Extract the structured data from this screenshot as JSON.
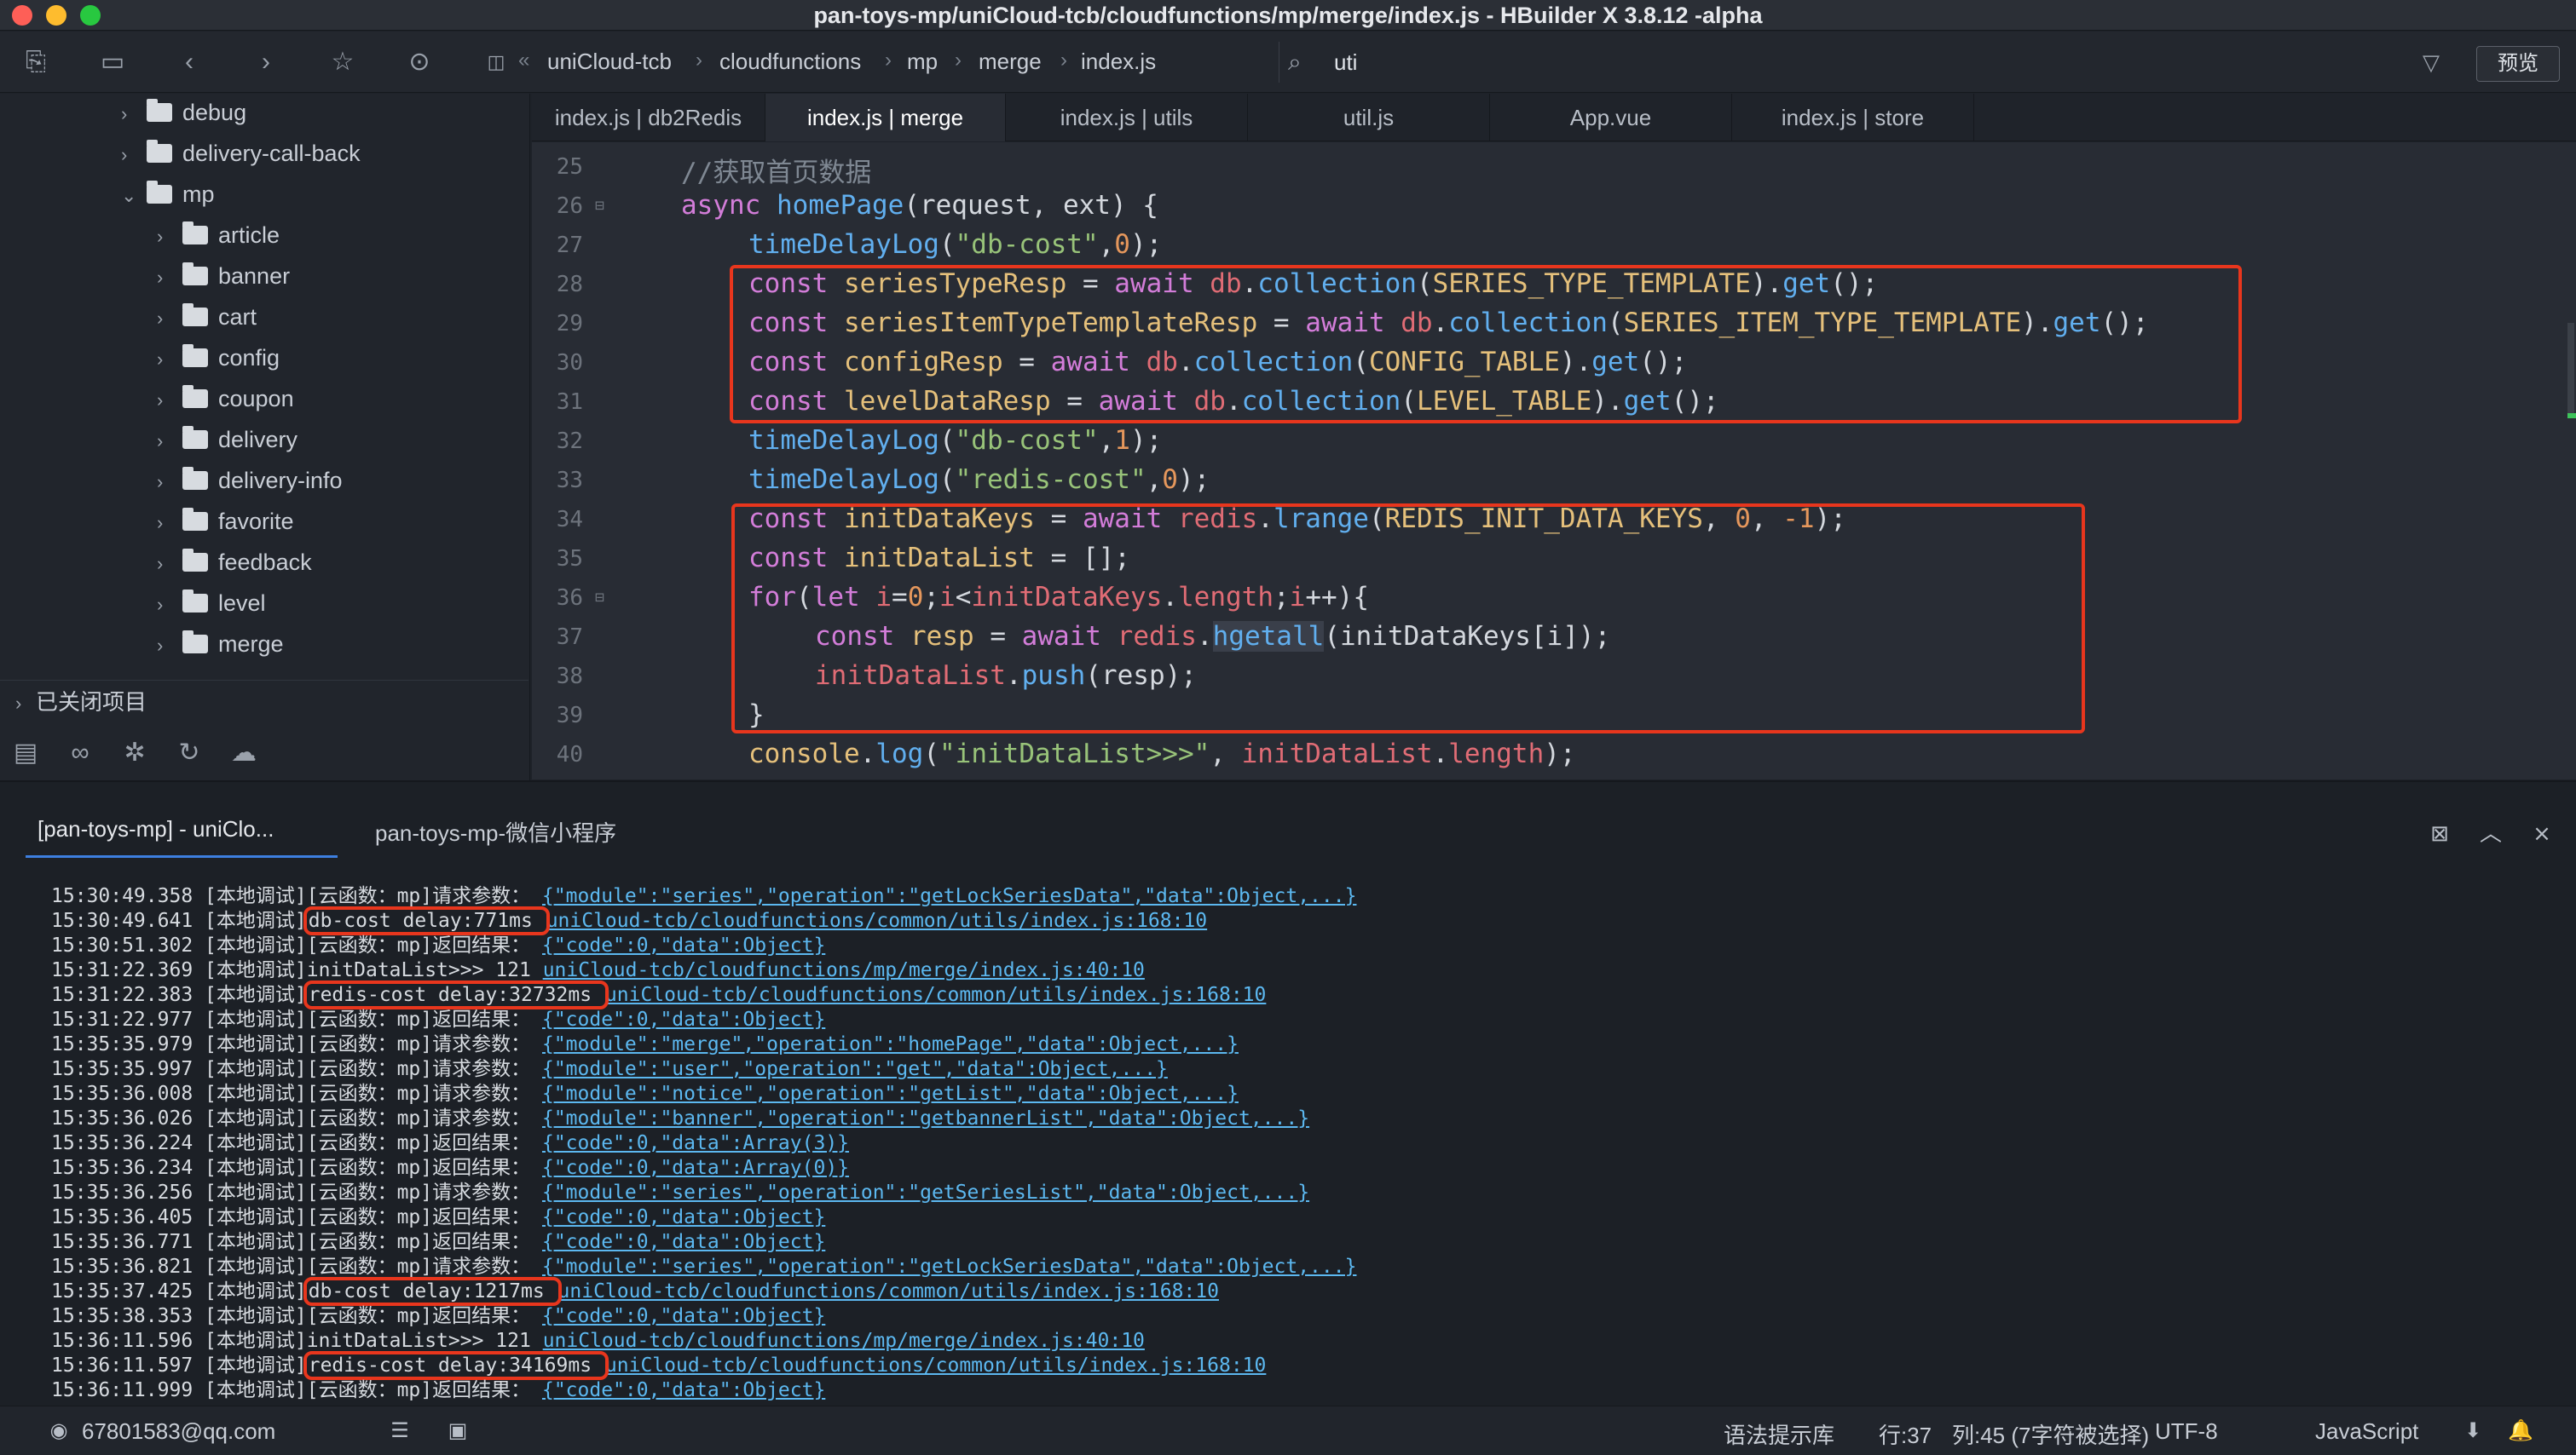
{
  "window": {
    "title": "pan-toys-mp/uniCloud-tcb/cloudfunctions/mp/merge/index.js - HBuilder X 3.8.12 -alpha"
  },
  "toolbar": {
    "breadcrumb": [
      "uniCloud-tcb",
      "cloudfunctions",
      "mp",
      "merge",
      "index.js"
    ],
    "search_value": "uti",
    "preview_label": "预览"
  },
  "sidebar": {
    "items": [
      {
        "label": "debug",
        "expanded": false,
        "level": 1
      },
      {
        "label": "delivery-call-back",
        "expanded": false,
        "level": 1
      },
      {
        "label": "mp",
        "expanded": true,
        "level": 1
      },
      {
        "label": "article",
        "expanded": false,
        "level": 2
      },
      {
        "label": "banner",
        "expanded": false,
        "level": 2
      },
      {
        "label": "cart",
        "expanded": false,
        "level": 2
      },
      {
        "label": "config",
        "expanded": false,
        "level": 2
      },
      {
        "label": "coupon",
        "expanded": false,
        "level": 2
      },
      {
        "label": "delivery",
        "expanded": false,
        "level": 2
      },
      {
        "label": "delivery-info",
        "expanded": false,
        "level": 2
      },
      {
        "label": "favorite",
        "expanded": false,
        "level": 2
      },
      {
        "label": "feedback",
        "expanded": false,
        "level": 2
      },
      {
        "label": "level",
        "expanded": false,
        "level": 2
      },
      {
        "label": "merge",
        "expanded": false,
        "level": 2
      }
    ],
    "closed_projects": "已关闭项目"
  },
  "tabs": [
    {
      "label": "index.js | db2Redis",
      "active": false
    },
    {
      "label": "index.js | merge",
      "active": true
    },
    {
      "label": "index.js | utils",
      "active": false
    },
    {
      "label": "util.js",
      "active": false
    },
    {
      "label": "App.vue",
      "active": false
    },
    {
      "label": "index.js | store",
      "active": false
    }
  ],
  "editor": {
    "line_numbers": [
      "25",
      "26",
      "27",
      "28",
      "29",
      "30",
      "31",
      "32",
      "33",
      "34",
      "35",
      "36",
      "37",
      "38",
      "39",
      "40"
    ]
  },
  "console": {
    "tabs": [
      "[pan-toys-mp] - uniClo...",
      "pan-toys-mp-微信小程序"
    ],
    "lines": [
      {
        "time": "15:30:49.358",
        "prefix": "[本地调试][云函数：mp]请求参数：",
        "text": "",
        "link": "{\"module\":\"series\",\"operation\":\"getLockSeriesData\",\"data\":Object,...}"
      },
      {
        "time": "15:30:49.641",
        "prefix": "[本地调试]",
        "text": "db-cost delay:771ms ",
        "link": "uniCloud-tcb/cloudfunctions/common/utils/index.js:168:10"
      },
      {
        "time": "15:30:51.302",
        "prefix": "[本地调试][云函数：mp]返回结果：",
        "text": "",
        "link": "{\"code\":0,\"data\":Object}"
      },
      {
        "time": "15:31:22.369",
        "prefix": "[本地调试]",
        "text": "initDataList>>> 121 ",
        "link": "uniCloud-tcb/cloudfunctions/mp/merge/index.js:40:10"
      },
      {
        "time": "15:31:22.383",
        "prefix": "[本地调试]",
        "text": "redis-cost delay:32732ms ",
        "link": "uniCloud-tcb/cloudfunctions/common/utils/index.js:168:10"
      },
      {
        "time": "15:31:22.977",
        "prefix": "[本地调试][云函数：mp]返回结果：",
        "text": "",
        "link": "{\"code\":0,\"data\":Object}"
      },
      {
        "time": "15:35:35.979",
        "prefix": "[本地调试][云函数：mp]请求参数：",
        "text": "",
        "link": "{\"module\":\"merge\",\"operation\":\"homePage\",\"data\":Object,...}"
      },
      {
        "time": "15:35:35.997",
        "prefix": "[本地调试][云函数：mp]请求参数：",
        "text": "",
        "link": "{\"module\":\"user\",\"operation\":\"get\",\"data\":Object,...}"
      },
      {
        "time": "15:35:36.008",
        "prefix": "[本地调试][云函数：mp]请求参数：",
        "text": "",
        "link": "{\"module\":\"notice\",\"operation\":\"getList\",\"data\":Object,...}"
      },
      {
        "time": "15:35:36.026",
        "prefix": "[本地调试][云函数：mp]请求参数：",
        "text": "",
        "link": "{\"module\":\"banner\",\"operation\":\"getbannerList\",\"data\":Object,...}"
      },
      {
        "time": "15:35:36.224",
        "prefix": "[本地调试][云函数：mp]返回结果：",
        "text": "",
        "link": "{\"code\":0,\"data\":Array(3)}"
      },
      {
        "time": "15:35:36.234",
        "prefix": "[本地调试][云函数：mp]返回结果：",
        "text": "",
        "link": "{\"code\":0,\"data\":Array(0)}"
      },
      {
        "time": "15:35:36.256",
        "prefix": "[本地调试][云函数：mp]请求参数：",
        "text": "",
        "link": "{\"module\":\"series\",\"operation\":\"getSeriesList\",\"data\":Object,...}"
      },
      {
        "time": "15:35:36.405",
        "prefix": "[本地调试][云函数：mp]返回结果：",
        "text": "",
        "link": "{\"code\":0,\"data\":Object}"
      },
      {
        "time": "15:35:36.771",
        "prefix": "[本地调试][云函数：mp]返回结果：",
        "text": "",
        "link": "{\"code\":0,\"data\":Object}"
      },
      {
        "time": "15:35:36.821",
        "prefix": "[本地调试][云函数：mp]请求参数：",
        "text": "",
        "link": "{\"module\":\"series\",\"operation\":\"getLockSeriesData\",\"data\":Object,...}"
      },
      {
        "time": "15:35:37.425",
        "prefix": "[本地调试]",
        "text": "db-cost delay:1217ms ",
        "link": "uniCloud-tcb/cloudfunctions/common/utils/index.js:168:10"
      },
      {
        "time": "15:35:38.353",
        "prefix": "[本地调试][云函数：mp]返回结果：",
        "text": "",
        "link": "{\"code\":0,\"data\":Object}"
      },
      {
        "time": "15:36:11.596",
        "prefix": "[本地调试]",
        "text": "initDataList>>> 121 ",
        "link": "uniCloud-tcb/cloudfunctions/mp/merge/index.js:40:10"
      },
      {
        "time": "15:36:11.597",
        "prefix": "[本地调试]",
        "text": "redis-cost delay:34169ms ",
        "link": "uniCloud-tcb/cloudfunctions/common/utils/index.js:168:10"
      },
      {
        "time": "15:36:11.999",
        "prefix": "[本地调试][云函数：mp]返回结果：",
        "text": "",
        "link": "{\"code\":0,\"data\":Object}"
      }
    ]
  },
  "statusbar": {
    "account": "67801583@qq.com",
    "syntax_lib": "语法提示库",
    "line": "行:37",
    "col": "列:45 (7字符被选择)",
    "encoding": "UTF-8",
    "language": "JavaScript"
  },
  "colors": {
    "highlight_box": "#e8361d",
    "link": "#5cb8f0",
    "accent": "#3d7fe0"
  }
}
